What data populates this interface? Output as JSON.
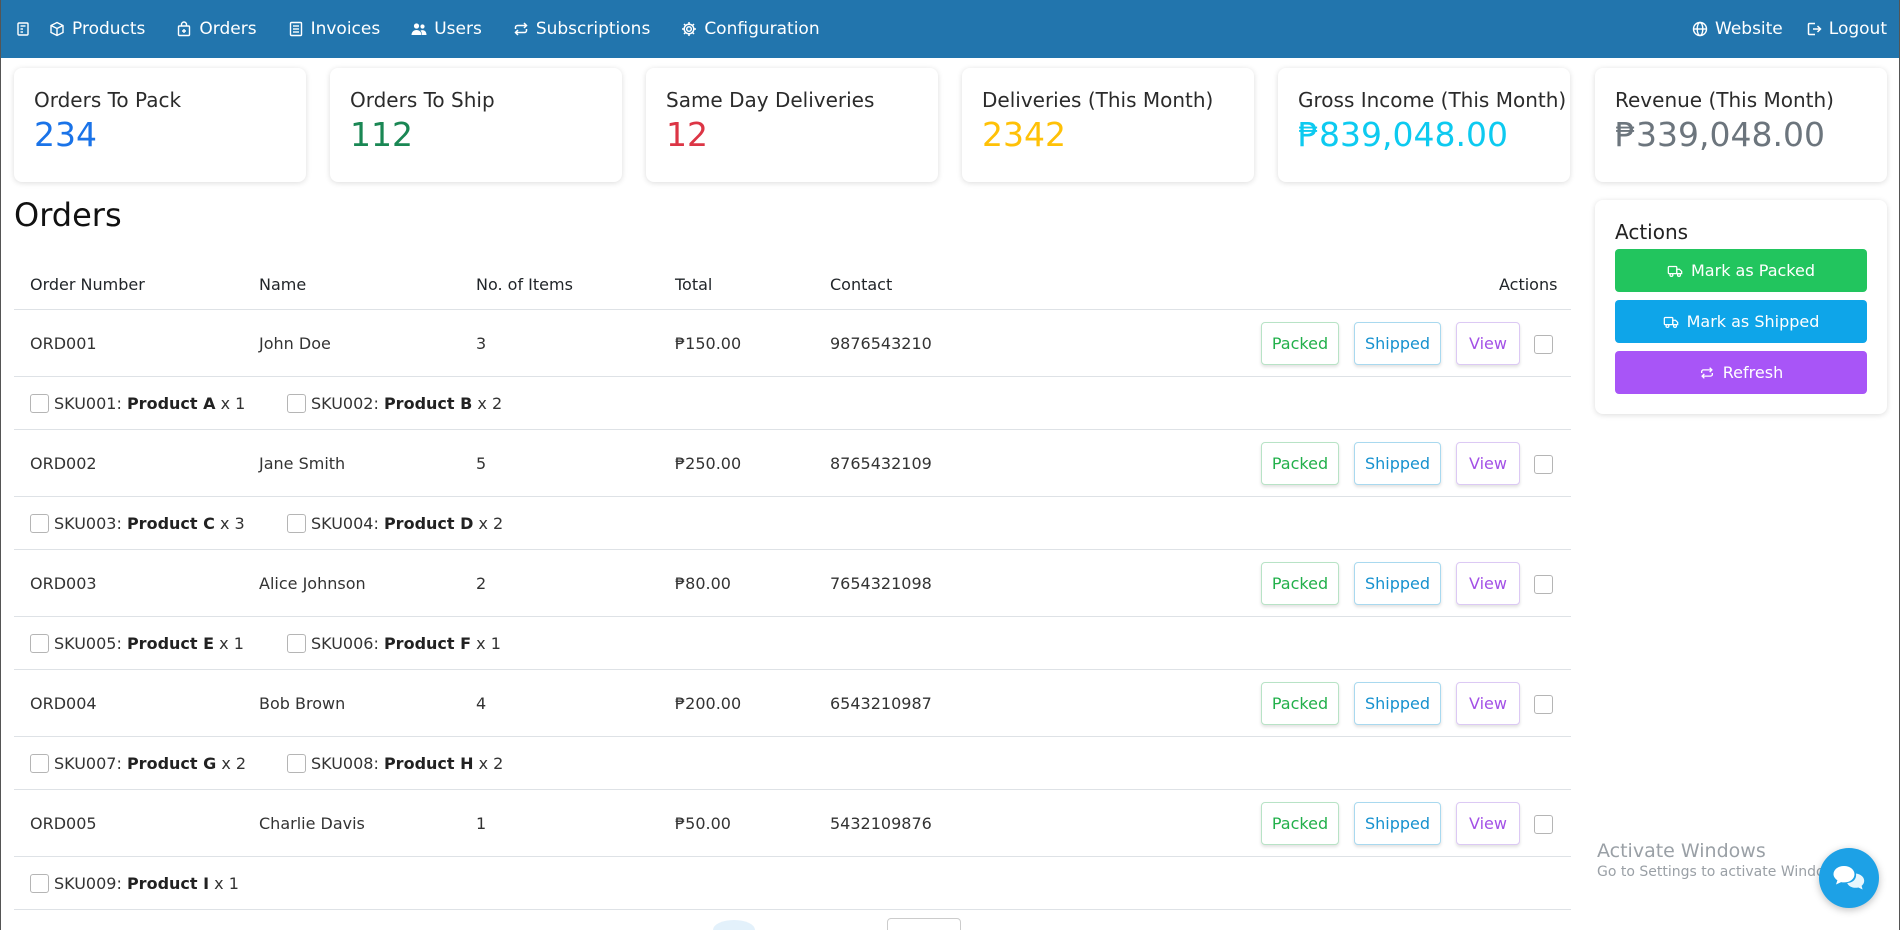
{
  "nav": {
    "items": [
      {
        "label": "Products",
        "icon": "box-icon"
      },
      {
        "label": "Orders",
        "icon": "bag-icon"
      },
      {
        "label": "Invoices",
        "icon": "list-icon"
      },
      {
        "label": "Users",
        "icon": "users-icon"
      },
      {
        "label": "Subscriptions",
        "icon": "repeat-icon"
      },
      {
        "label": "Configuration",
        "icon": "gear-icon"
      }
    ],
    "website": "Website",
    "logout": "Logout"
  },
  "stats": [
    {
      "title": "Orders To Pack",
      "value": "234",
      "color": "#1a73e8"
    },
    {
      "title": "Orders To Ship",
      "value": "112",
      "color": "#1a8754"
    },
    {
      "title": "Same Day Deliveries",
      "value": "12",
      "color": "#dc3545"
    },
    {
      "title": "Deliveries (This Month)",
      "value": "2342",
      "color": "#ffc107"
    },
    {
      "title": "Gross Income (This Month)",
      "value": "₱839,048.00",
      "color": "#0dcaf0"
    },
    {
      "title": "Revenue (This Month)",
      "value": "₱339,048.00",
      "color": "#6c757d"
    }
  ],
  "orders": {
    "title": "Orders",
    "columns": [
      "Order Number",
      "Name",
      "No. of Items",
      "Total",
      "Contact",
      "Actions"
    ],
    "rows": [
      {
        "number": "ORD001",
        "name": "John Doe",
        "items": "3",
        "total": "₱150.00",
        "contact": "9876543210",
        "skus": [
          {
            "sku": "SKU001:",
            "product": "Product A",
            "qty": "x 1"
          },
          {
            "sku": "SKU002:",
            "product": "Product B",
            "qty": "x 2"
          }
        ]
      },
      {
        "number": "ORD002",
        "name": "Jane Smith",
        "items": "5",
        "total": "₱250.00",
        "contact": "8765432109",
        "skus": [
          {
            "sku": "SKU003:",
            "product": "Product C",
            "qty": "x 3"
          },
          {
            "sku": "SKU004:",
            "product": "Product D",
            "qty": "x 2"
          }
        ]
      },
      {
        "number": "ORD003",
        "name": "Alice Johnson",
        "items": "2",
        "total": "₱80.00",
        "contact": "7654321098",
        "skus": [
          {
            "sku": "SKU005:",
            "product": "Product E",
            "qty": "x 1"
          },
          {
            "sku": "SKU006:",
            "product": "Product F",
            "qty": "x 1"
          }
        ]
      },
      {
        "number": "ORD004",
        "name": "Bob Brown",
        "items": "4",
        "total": "₱200.00",
        "contact": "6543210987",
        "skus": [
          {
            "sku": "SKU007:",
            "product": "Product G",
            "qty": "x 2"
          },
          {
            "sku": "SKU008:",
            "product": "Product H",
            "qty": "x 2"
          }
        ]
      },
      {
        "number": "ORD005",
        "name": "Charlie Davis",
        "items": "1",
        "total": "₱50.00",
        "contact": "5432109876",
        "skus": [
          {
            "sku": "SKU009:",
            "product": "Product I",
            "qty": "x 1"
          }
        ]
      }
    ],
    "buttons": {
      "packed": "Packed",
      "shipped": "Shipped",
      "view": "View"
    }
  },
  "actions": {
    "title": "Actions",
    "mark_packed": "Mark as Packed",
    "mark_shipped": "Mark as Shipped",
    "refresh": "Refresh",
    "colors": {
      "packed": "#22c55e",
      "shipped": "#0ea5e9",
      "refresh": "#a855f7"
    }
  },
  "watermark": {
    "line1": "Activate Windows",
    "line2": "Go to Settings to activate Windows."
  }
}
